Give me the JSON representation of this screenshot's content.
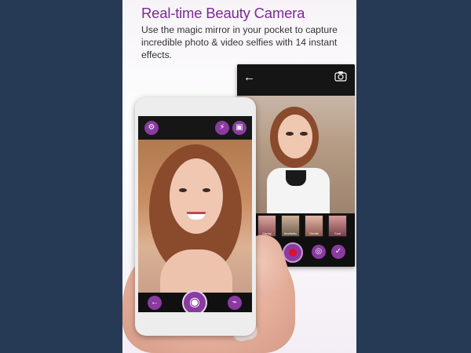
{
  "headline": "Real-time Beauty Camera",
  "description": "Use the magic mirror in your pocket to capture incredible photo & video selfies with 14 instant effects.",
  "back_screen": {
    "thumbnails": [
      {
        "label": "Candy"
      },
      {
        "label": "Aesthetic"
      },
      {
        "label": "Gentle"
      },
      {
        "label": "Cool"
      }
    ]
  },
  "icons": {
    "back": "arrow-left-icon",
    "camera_switch": "camera-switch-icon",
    "record": "record-icon",
    "camera_effects": "camera-effects-icon",
    "confirm": "check-icon",
    "settings": "settings-icon",
    "flash": "flash-icon",
    "mode": "mode-icon",
    "shutter": "shutter-icon"
  },
  "colors": {
    "accent": "#8a3aa0",
    "headline": "#7b2a93",
    "background": "#263a55"
  }
}
